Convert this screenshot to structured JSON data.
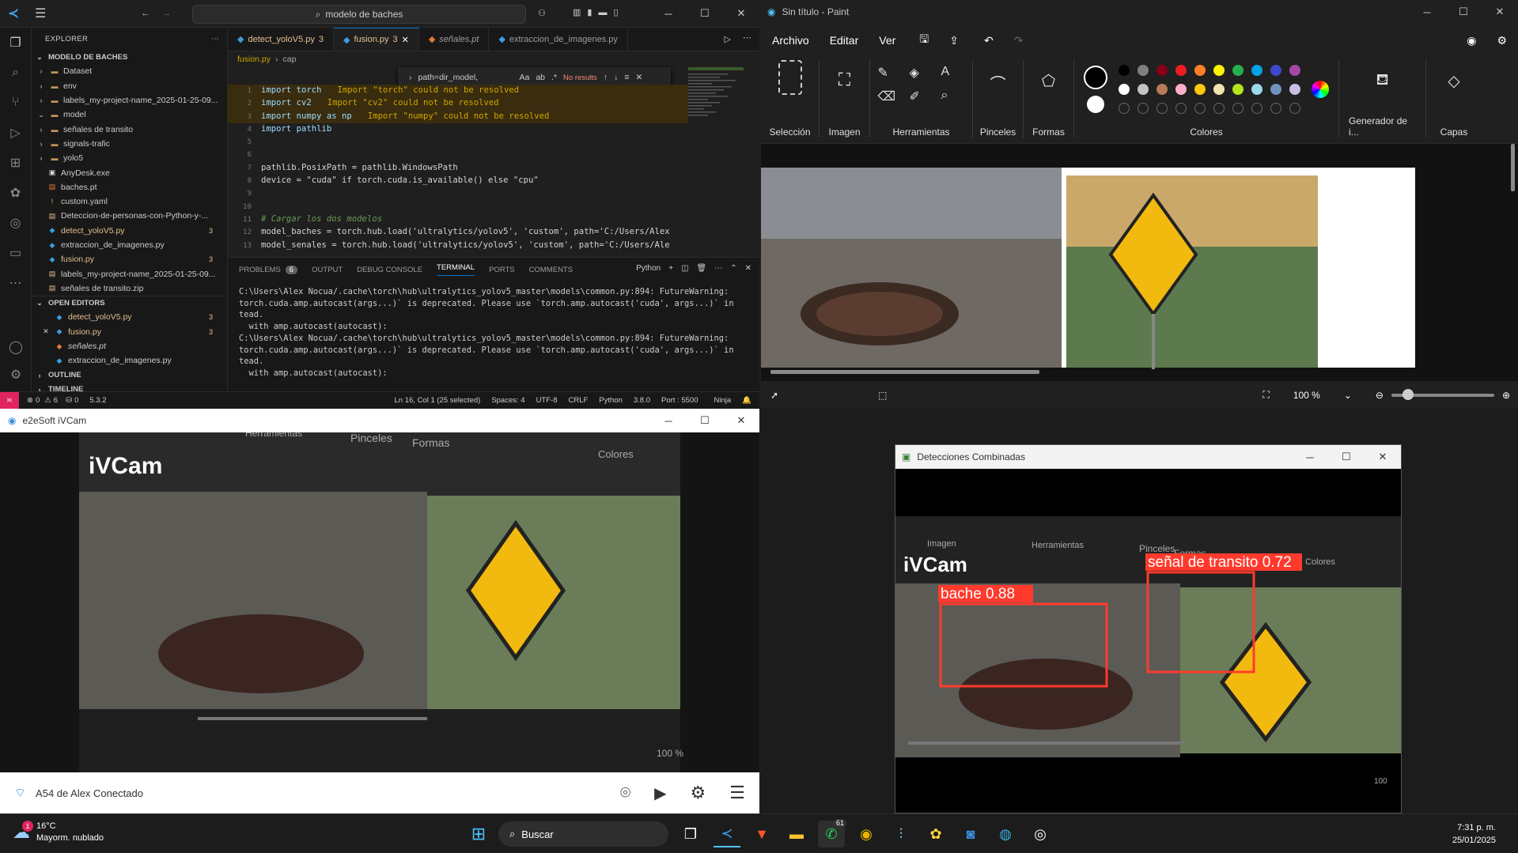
{
  "vscode": {
    "search_text": "modelo de baches",
    "explorer_title": "EXPLORER",
    "folder_title": "MODELO DE BACHES",
    "tree": [
      {
        "name": "Dataset",
        "type": "folder"
      },
      {
        "name": "env",
        "type": "folder"
      },
      {
        "name": "labels_my-project-name_2025-01-25-09...",
        "type": "folder"
      },
      {
        "name": "model",
        "type": "folder-open"
      },
      {
        "name": "señales de transito",
        "type": "folder"
      },
      {
        "name": "signals-trafic",
        "type": "folder"
      },
      {
        "name": "yolo5",
        "type": "folder"
      },
      {
        "name": "AnyDesk.exe",
        "type": "exe"
      },
      {
        "name": "baches.pt",
        "type": "pt"
      },
      {
        "name": "custom.yaml",
        "type": "yaml"
      },
      {
        "name": "Deteccion-de-personas-con-Python-y-...",
        "type": "zip"
      },
      {
        "name": "detect_yoloV5.py",
        "type": "py",
        "badge": "3"
      },
      {
        "name": "extraccion_de_imagenes.py",
        "type": "py"
      },
      {
        "name": "fusion.py",
        "type": "py",
        "badge": "3"
      },
      {
        "name": "labels_my-project-name_2025-01-25-09...",
        "type": "zip"
      },
      {
        "name": "señales de transito.zip",
        "type": "zip"
      }
    ],
    "open_editors_title": "OPEN EDITORS",
    "open_editors": [
      {
        "name": "detect_yoloV5.py",
        "badge": "3"
      },
      {
        "name": "fusion.py",
        "badge": "3"
      },
      {
        "name": "señales.pt"
      },
      {
        "name": "extraccion_de_imagenes.py"
      }
    ],
    "outline_title": "OUTLINE",
    "timeline_title": "TIMELINE",
    "tabs": [
      {
        "label": "detect_yoloV5.py",
        "badge": "3",
        "active": false
      },
      {
        "label": "fusion.py",
        "badge": "3",
        "active": true
      },
      {
        "label": "señales.pt",
        "active": false
      },
      {
        "label": "extraccion_de_imagenes.py",
        "active": false
      }
    ],
    "breadcrumb": [
      "fusion.py",
      "cap"
    ],
    "find_text": "path=dir_model,",
    "find_result": "No results",
    "code": [
      {
        "n": "1",
        "t": "import torch",
        "w": "Import \"torch\" could not be resolved"
      },
      {
        "n": "2",
        "t": "import cv2",
        "w": "Import \"cv2\" could not be resolved"
      },
      {
        "n": "3",
        "t": "import numpy as np",
        "w": "Import \"numpy\" could not be resolved"
      },
      {
        "n": "4",
        "t": "import pathlib",
        "w": ""
      },
      {
        "n": "5",
        "t": "",
        "w": ""
      },
      {
        "n": "6",
        "t": "",
        "w": ""
      },
      {
        "n": "7",
        "t": "pathlib.PosixPath = pathlib.WindowsPath",
        "w": ""
      },
      {
        "n": "8",
        "t": "device = \"cuda\" if torch.cuda.is_available() else \"cpu\"",
        "w": ""
      },
      {
        "n": "9",
        "t": "",
        "w": ""
      },
      {
        "n": "10",
        "t": "",
        "w": ""
      },
      {
        "n": "11",
        "t": "# Cargar los dos modelos",
        "w": ""
      },
      {
        "n": "12",
        "t": "model_baches = torch.hub.load('ultralytics/yolov5', 'custom', path='C:/Users/Alex",
        "w": ""
      },
      {
        "n": "13",
        "t": "model_senales = torch.hub.load('ultralytics/yolov5', 'custom', path='C:/Users/Ale",
        "w": ""
      }
    ],
    "panel_tabs": [
      "PROBLEMS",
      "OUTPUT",
      "DEBUG CONSOLE",
      "TERMINAL",
      "PORTS",
      "COMMENTS"
    ],
    "problems_count": "6",
    "terminal_lang": "Python",
    "terminal": "C:\\Users\\Alex Nocua/.cache\\torch\\hub\\ultralytics_yolov5_master\\models\\common.py:894: FutureWarning: `\ntorch.cuda.amp.autocast(args...)` is deprecated. Please use `torch.amp.autocast('cuda', args...)` ins\ntead.\n  with amp.autocast(autocast):\nC:\\Users\\Alex Nocua/.cache\\torch\\hub\\ultralytics_yolov5_master\\models\\common.py:894: FutureWarning: `\ntorch.cuda.amp.autocast(args...)` is deprecated. Please use `torch.amp.autocast('cuda', args...)` ins\ntead.\n  with amp.autocast(autocast):",
    "status": {
      "errors": "0",
      "warnings": "6",
      "ports": "0",
      "version_left": "5.3.2",
      "position": "Ln 16, Col 1 (25 selected)",
      "spaces": "Spaces: 4",
      "encoding": "UTF-8",
      "eol": "CRLF",
      "language": "Python",
      "py_version": "3.8.0",
      "port": "Port : 5500",
      "ninja": "Ninja"
    }
  },
  "paint": {
    "title": "Sin título - Paint",
    "menu": [
      "Archivo",
      "Editar",
      "Ver"
    ],
    "groups": [
      "Selección",
      "Imagen",
      "Herramientas",
      "Pinceles",
      "Formas",
      "Colores",
      "Generador de i...",
      "Capas"
    ],
    "palette_row1": [
      "#000000",
      "#7f7f7f",
      "#880015",
      "#ed1c24",
      "#ff7f27",
      "#fff200",
      "#22b14c",
      "#00a2e8",
      "#3f48cc",
      "#a349a4"
    ],
    "palette_row2": [
      "#ffffff",
      "#c3c3c3",
      "#b97a57",
      "#ffaec9",
      "#ffc90e",
      "#efe4b0",
      "#b5e61d",
      "#99d9ea",
      "#7092be",
      "#c8bfe7"
    ],
    "zoom": "100 %"
  },
  "ivcam": {
    "title": "e2eSoft iVCam",
    "connection": "A54 de Alex Conectado",
    "overlay_brand": "iVCam",
    "overlay_labels": [
      "Herramientas",
      "Pinceles",
      "Formas",
      "Colores"
    ],
    "overlay_zoom": "100 %"
  },
  "detections": {
    "title": "Detecciones Combinadas",
    "overlay_brand": "iVCam",
    "overlay_labels": [
      "Imagen",
      "Herramientas",
      "Pinceles",
      "Formas",
      "Colores"
    ],
    "overlay_zoom": "100",
    "boxes": [
      {
        "label": "bache 0.88",
        "class": "bache",
        "confidence": 0.88
      },
      {
        "label": "señal de transito 0.72",
        "class": "señal de transito",
        "confidence": 0.72
      }
    ],
    "box_color": "#ff3a2d"
  },
  "taskbar": {
    "temp": "16°C",
    "weather": "Mayorm. nublado",
    "weather_badge": "1",
    "search": "Buscar",
    "whatsapp_badge": "61",
    "time": "7:31 p. m.",
    "date": "25/01/2025"
  }
}
